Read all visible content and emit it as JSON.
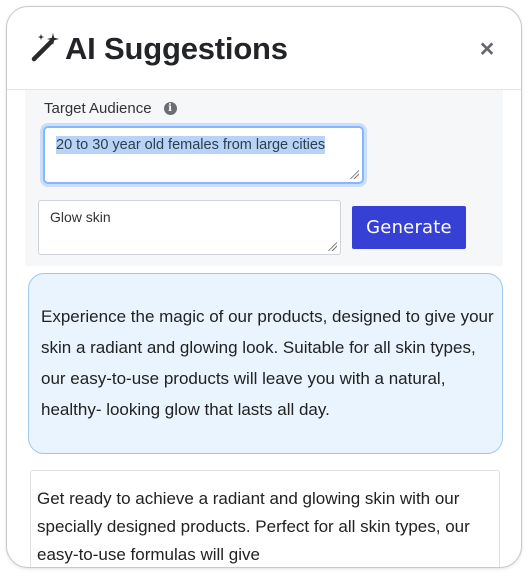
{
  "header": {
    "title": "AI Suggestions",
    "icon": "magic-wand-icon",
    "close_icon": "close-icon",
    "close_label": "×"
  },
  "form": {
    "target_audience_label": "Target Audience",
    "target_audience_info_icon": "info-icon",
    "target_audience_value": "20 to 30 year old females from large cities",
    "keywords_value": "Glow skin",
    "generate_label": "Generate"
  },
  "suggestions": [
    "Experience the magic of our products, designed to give your skin a radiant and glowing look.  Suitable for all skin types, our easy-to-use products will  leave you with a natural, healthy-   looking glow that lasts all day.",
    "Get ready to achieve a radiant and glowing skin with our specially designed products. Perfect for all skin types, our easy-to-use formulas will give"
  ],
  "colors": {
    "accent": "#3640d4",
    "selected_card_bg": "#e9f4fe",
    "selected_card_border": "#9ec8ef",
    "text_selection": "#b7d3f5"
  }
}
